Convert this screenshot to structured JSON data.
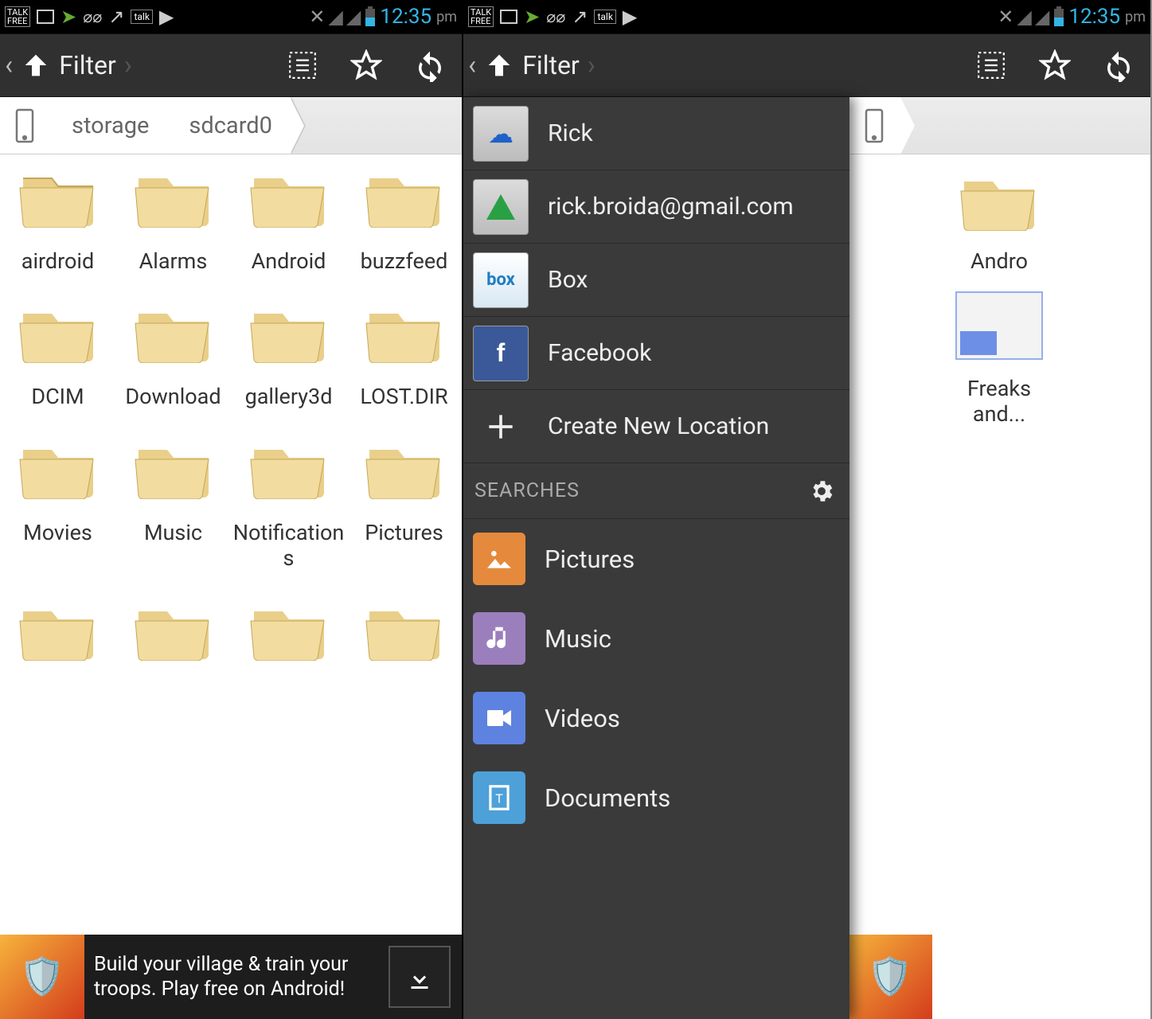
{
  "status": {
    "time": "12:35",
    "ampm": "pm"
  },
  "actionbar": {
    "title": "Filter"
  },
  "breadcrumb": {
    "seg1": "storage",
    "seg2": "sdcard0"
  },
  "folders": {
    "f0": "airdroid",
    "f1": "Alarms",
    "f2": "Android",
    "f3": "buzzfeed",
    "f4": "DCIM",
    "f5": "Download",
    "f6": "gallery3d",
    "f7": "LOST.DIR",
    "f8": "Movies",
    "f9": "Music",
    "f10": "Notifications",
    "f11": "Pictures"
  },
  "ad": {
    "line": "Build your village & train your troops. Play free on Android!"
  },
  "drawer": {
    "loc0": "Rick",
    "loc1": "rick.broida@gmail.com",
    "loc2": "Box",
    "loc3": "Facebook",
    "new_location": "Create New Location",
    "section": "SEARCHES",
    "s0": "Pictures",
    "s1": "Music",
    "s2": "Videos",
    "s3": "Documents"
  },
  "right_items": {
    "i0": "Andro",
    "i1": "Freaks and..."
  }
}
